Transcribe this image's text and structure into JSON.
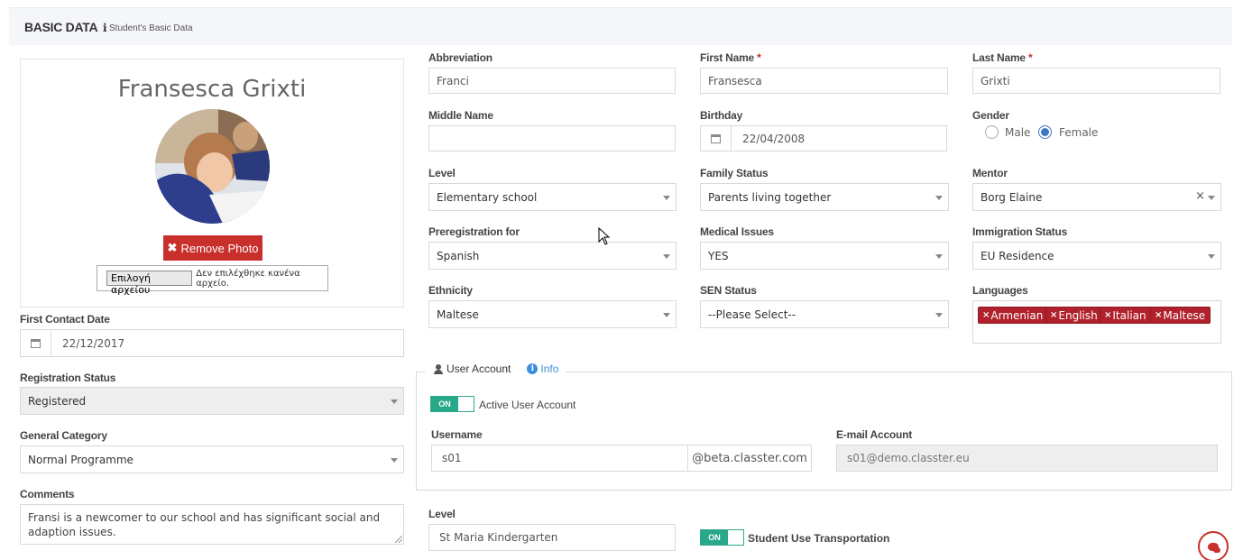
{
  "header": {
    "title": "BASIC DATA",
    "info_icon": "i",
    "subtitle": "Student's Basic Data"
  },
  "profile": {
    "name": "Fransesca Grixti",
    "remove_photo_label": "Remove Photo",
    "file_button_label": "Επιλογή αρχείου",
    "file_status": "Δεν επιλέχθηκε κανένα αρχείο."
  },
  "left_fields": {
    "first_contact_date": {
      "label": "First Contact Date",
      "value": "22/12/2017"
    },
    "registration_status": {
      "label": "Registration Status",
      "value": "Registered"
    },
    "general_category": {
      "label": "General Category",
      "value": "Normal Programme"
    },
    "comments": {
      "label": "Comments",
      "value": "Fransi is a newcomer to our school and has significant social and adaption issues."
    }
  },
  "fields": {
    "abbreviation": {
      "label": "Abbreviation",
      "value": "Franci"
    },
    "first_name": {
      "label": "First Name",
      "required": "*",
      "value": "Fransesca"
    },
    "last_name": {
      "label": "Last Name",
      "required": "*",
      "value": "Grixti"
    },
    "middle_name": {
      "label": "Middle Name",
      "value": ""
    },
    "birthday": {
      "label": "Birthday",
      "value": "22/04/2008"
    },
    "gender": {
      "label": "Gender",
      "options": [
        "Male",
        "Female"
      ],
      "selected": "Female"
    },
    "level": {
      "label": "Level",
      "value": "Elementary school"
    },
    "family_status": {
      "label": "Family Status",
      "value": "Parents living together"
    },
    "mentor": {
      "label": "Mentor",
      "value": "Borg Elaine",
      "clear": "×"
    },
    "preregistration_for": {
      "label": "Preregistration for",
      "value": "Spanish"
    },
    "medical_issues": {
      "label": "Medical Issues",
      "value": "YES"
    },
    "immigration_status": {
      "label": "Immigration Status",
      "value": "EU Residence"
    },
    "ethnicity": {
      "label": "Ethnicity",
      "value": "Maltese"
    },
    "sen_status": {
      "label": "SEN Status",
      "value": "--Please Select--"
    },
    "languages": {
      "label": "Languages",
      "tags": [
        "Armenian",
        "English",
        "Italian",
        "Maltese"
      ],
      "remove_glyph": "×"
    }
  },
  "user_account": {
    "legend": "User Account",
    "info_label": "Info",
    "info_icon": "i",
    "toggle_on": "ON",
    "active_label": "Active User Account",
    "username_label": "Username",
    "username_value": "s01",
    "username_suffix": "@beta.classter.com",
    "email_label": "E-mail Account",
    "email_value": "s01@demo.classter.eu"
  },
  "transport": {
    "level_label": "Level",
    "level_value": "St Maria Kindergarten",
    "toggle_on": "ON",
    "transport_label": "Student Use Transportation"
  },
  "colors": {
    "danger": "#c9302c",
    "tag": "#b0212b",
    "toggle": "#26a889",
    "info": "#3b8fd8",
    "radio": "#3b78c3"
  },
  "icons": {
    "remove": "times-icon",
    "calendar": "calendar-icon",
    "user": "user-icon",
    "info": "info-circle-icon",
    "chat": "chat-icon"
  }
}
